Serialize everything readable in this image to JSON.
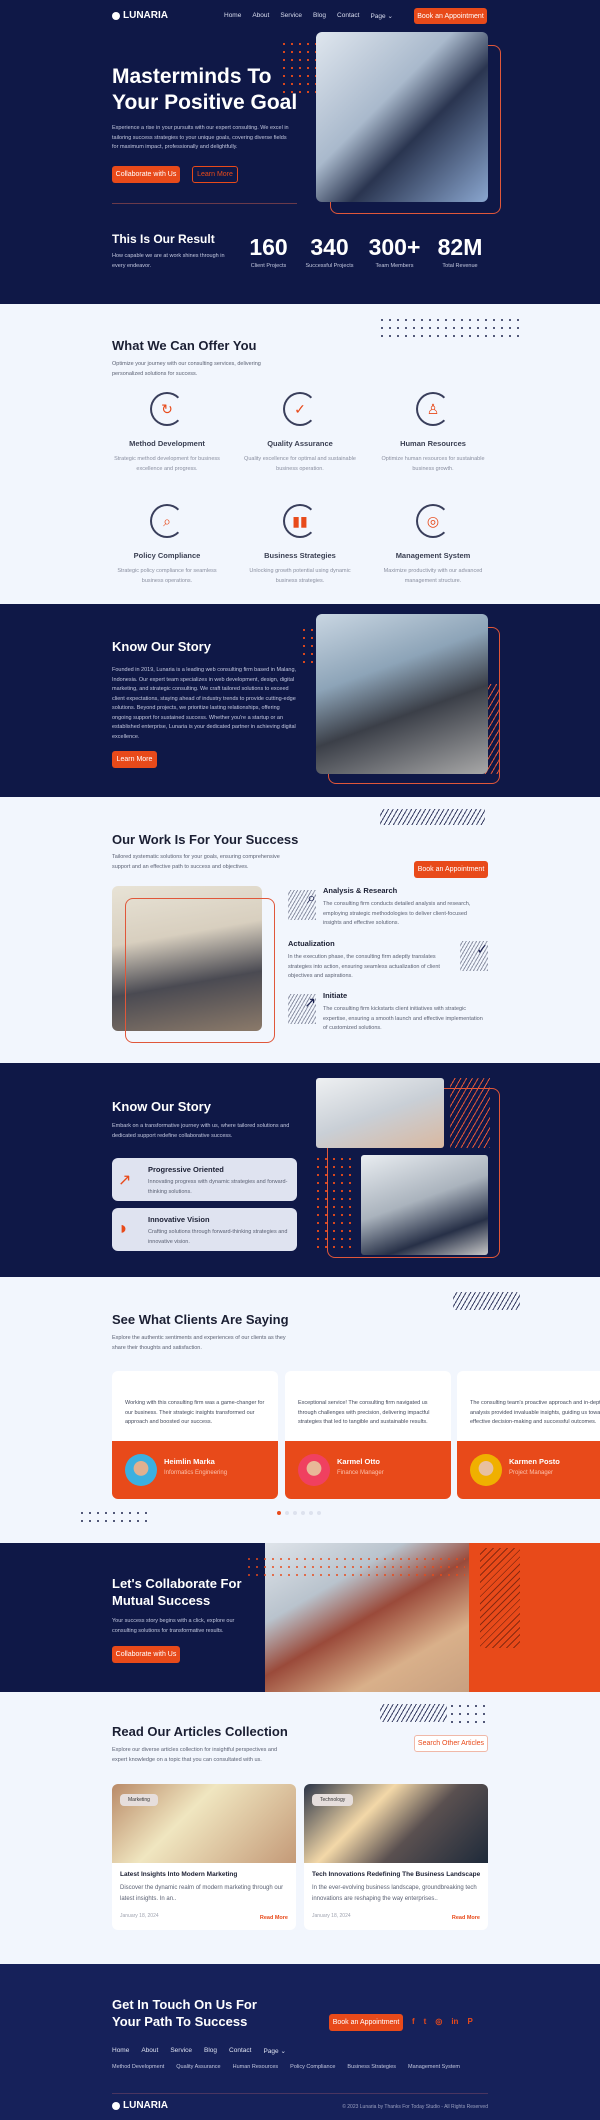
{
  "brand": {
    "name": "LUNARIA",
    "accent": "#e84a1a",
    "navy": "#0f1847"
  },
  "nav": {
    "items": [
      "Home",
      "About",
      "Service",
      "Blog",
      "Contact",
      "Page"
    ],
    "cta": "Book an Appointment"
  },
  "hero": {
    "title_line1": "Masterminds To",
    "title_line2": "Your Positive Goal",
    "text": "Experience a rise in your pursuits with our expert consulting. We excel in tailoring success strategies to your unique goals, covering diverse fields for maximum impact, professionally and delightfully.",
    "primary": "Collaborate with Us",
    "secondary": "Learn More"
  },
  "results": {
    "title": "This Is Our Result",
    "text": "How capable we are at work shines through in every endeavor.",
    "stats": [
      {
        "value": "160",
        "label": "Client Projects"
      },
      {
        "value": "340",
        "label": "Successful Projects"
      },
      {
        "value": "300+",
        "label": "Team Members"
      },
      {
        "value": "82M",
        "label": "Total Revenue"
      }
    ]
  },
  "offer": {
    "title": "What We Can Offer You",
    "text": "Optimize your journey with our consulting services, delivering personalized solutions for success.",
    "services": [
      {
        "icon": "refresh-icon",
        "title": "Method Development",
        "text": "Strategic method development for business excellence and progress."
      },
      {
        "icon": "check-icon",
        "title": "Quality Assurance",
        "text": "Quality excellence for optimal and sustainable business operation."
      },
      {
        "icon": "person-icon",
        "title": "Human Resources",
        "text": "Optimize human resources for sustainable business growth."
      },
      {
        "icon": "magnifier-icon",
        "title": "Policy Compliance",
        "text": "Strategic policy compliance for seamless business operations."
      },
      {
        "icon": "bar-chart-icon",
        "title": "Business Strategies",
        "text": "Unlocking growth potential using dynamic business strategies."
      },
      {
        "icon": "target-icon",
        "title": "Management System",
        "text": "Maximize productivity with our advanced management structure."
      }
    ]
  },
  "story": {
    "title": "Know Our Story",
    "text": "Founded in 2019, Lunaria is a leading web consulting firm based in Malang, Indonesia. Our expert team specializes in web development, design, digital marketing, and strategic consulting. We craft tailored solutions to exceed client expectations, staying ahead of industry trends to provide cutting-edge solutions. Beyond projects, we prioritize lasting relationships, offering ongoing support for sustained success. Whether you're a startup or an established enterprise, Lunaria is your dedicated partner in achieving digital excellence.",
    "button": "Learn More"
  },
  "work": {
    "title": "Our Work Is For Your Success",
    "text": "Tailored systematic solutions for your goals, ensuring comprehensive support and an effective path to success and objectives.",
    "button": "Book an Appointment",
    "steps": [
      {
        "title": "Analysis & Research",
        "text": "The consulting firm conducts detailed analysis and research, employing strategic methodologies to deliver client-focused insights and effective solutions."
      },
      {
        "title": "Actualization",
        "text": "In the execution phase, the consulting firm adeptly translates strategies into action, ensuring seamless actualization of client objectives and aspirations."
      },
      {
        "title": "Initiate",
        "text": "The consulting firm kickstarts client initiatives with strategic expertise, ensuring a smooth launch and effective implementation of customized solutions."
      }
    ]
  },
  "story2": {
    "title": "Know Our Story",
    "text": "Embark on a transformative journey with us, where tailored solutions and dedicated support redefine collaborative success.",
    "features": [
      {
        "title": "Progressive Oriented",
        "text": "Innovating progress with dynamic strategies and forward-thinking solutions."
      },
      {
        "title": "Innovative Vision",
        "text": "Crafting solutions through forward-thinking strategies and innovative vision."
      }
    ]
  },
  "testimonials": {
    "title": "See What Clients Are Saying",
    "text": "Explore the authentic sentiments and experiences of our clients as they share their thoughts and satisfaction.",
    "items": [
      {
        "quote": "Working with this consulting firm was a game-changer for our business. Their strategic insights transformed our approach and boosted our success.",
        "name": "Heimlin Marka",
        "role": "Informatics Engineering"
      },
      {
        "quote": "Exceptional service! The consulting firm navigated us through challenges with precision, delivering impactful strategies that led to tangible and sustainable results.",
        "name": "Karmel Otto",
        "role": "Finance Manager"
      },
      {
        "quote": "The consulting team's proactive approach and in-depth analysis provided invaluable insights, guiding us towards effective decision-making and successful outcomes.",
        "name": "Karmen Posto",
        "role": "Project Manager"
      }
    ]
  },
  "collab": {
    "title_line1": "Let's Collaborate For",
    "title_line2": "Mutual Success",
    "text": "Your success story begins with a click, explore our consulting solutions for transformative results.",
    "button": "Collaborate with Us"
  },
  "articles": {
    "title": "Read Our Articles Collection",
    "text": "Explore our diverse articles collection for insightful perspectives and expert knowledge on a topic that you can consultated with us.",
    "button": "Search Other Articles",
    "items": [
      {
        "tag": "Marketing",
        "title": "Latest Insights Into Modern Marketing",
        "text": "Discover the dynamic realm of modern marketing through our latest insights. In an..",
        "date": "January 18, 2024",
        "link": "Read More"
      },
      {
        "tag": "Technology",
        "title": "Tech Innovations Redefining The Business Landscape",
        "text": "In the ever-evolving business landscape, groundbreaking tech innovations are reshaping the way enterprises..",
        "date": "January 18, 2024",
        "link": "Read More"
      }
    ]
  },
  "footer": {
    "title_line1": "Get In Touch On Us For",
    "title_line2": "Your Path To Success",
    "button": "Book an Appointment",
    "social": [
      "facebook-icon",
      "twitter-icon",
      "instagram-icon",
      "linkedin-icon",
      "pinterest-icon"
    ],
    "nav": [
      "Home",
      "About",
      "Service",
      "Blog",
      "Contact",
      "Page"
    ],
    "services": [
      "Method Development",
      "Quality Assurance",
      "Human Resources",
      "Policy Compliance",
      "Business Strategies",
      "Management System"
    ],
    "copyright": "© 2023 Lunaria by Thanks For Today Studio - All Rights Reserved"
  }
}
